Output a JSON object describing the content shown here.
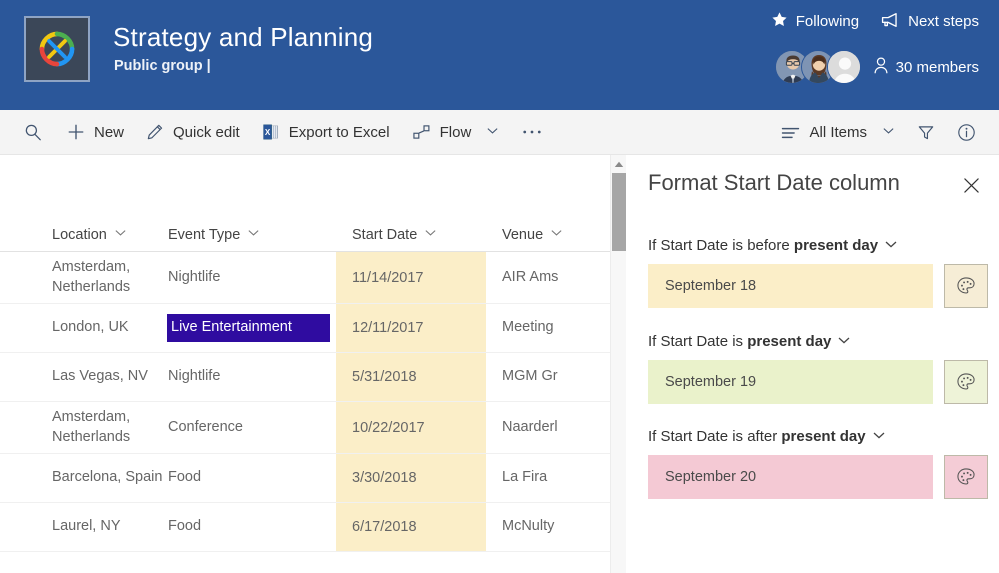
{
  "header": {
    "logo_icon": "group-knot-logo",
    "title": "Strategy and Planning",
    "subtitle": "Public group |",
    "actions": [
      {
        "icon": "star-icon",
        "label": "Following"
      },
      {
        "icon": "megaphone-icon",
        "label": "Next steps"
      }
    ],
    "members": {
      "icon": "person-icon",
      "label": "30 members",
      "avatars": [
        "avatar-man-glasses",
        "avatar-woman",
        "avatar-placeholder"
      ]
    },
    "bg_color": "#2b579a"
  },
  "command_bar": {
    "left_items": [
      {
        "icon": "search-icon",
        "label": ""
      },
      {
        "icon": "plus-icon",
        "label": "New"
      },
      {
        "icon": "pencil-icon",
        "label": "Quick edit"
      },
      {
        "icon": "excel-icon",
        "label": "Export to Excel"
      },
      {
        "icon": "flow-icon",
        "label": "Flow",
        "chevron": true
      },
      {
        "icon": "ellipsis-icon",
        "label": ""
      }
    ],
    "right_items": [
      {
        "icon": "list-icon",
        "label": "All Items",
        "chevron": true
      },
      {
        "icon": "filter-icon",
        "label": ""
      },
      {
        "icon": "info-icon",
        "label": ""
      }
    ]
  },
  "table": {
    "columns": [
      {
        "label": "Location",
        "sort_icon": "chevron-down-icon"
      },
      {
        "label": "Event Type",
        "sort_icon": "chevron-down-icon"
      },
      {
        "label": "Start Date",
        "sort_icon": "chevron-down-icon"
      },
      {
        "label": "Venue",
        "sort_icon": "chevron-down-icon"
      }
    ],
    "date_highlight_color": "#fbeec8",
    "type_highlight_bg": "#2f0ca0",
    "type_highlight_fg": "#ffffff",
    "rows": [
      {
        "location": "Amsterdam, Netherlands",
        "event_type": "Nightlife",
        "start_date": "11/14/2017",
        "venue": "AIR Ams",
        "type_highlighted": false
      },
      {
        "location": "London, UK",
        "event_type": "Live Entertainment",
        "start_date": "12/11/2017",
        "venue": "Meeting",
        "type_highlighted": true
      },
      {
        "location": "Las Vegas, NV",
        "event_type": "Nightlife",
        "start_date": "5/31/2018",
        "venue": "MGM Gr",
        "type_highlighted": false
      },
      {
        "location": "Amsterdam, Netherlands",
        "event_type": "Conference",
        "start_date": "10/22/2017",
        "venue": "Naarderl",
        "type_highlighted": false
      },
      {
        "location": "Barcelona, Spain",
        "event_type": "Food",
        "start_date": "3/30/2018",
        "venue": "La Fira",
        "type_highlighted": false
      },
      {
        "location": "Laurel, NY",
        "event_type": "Food",
        "start_date": "6/17/2018",
        "venue": "McNulty",
        "type_highlighted": false
      }
    ]
  },
  "scrollbar": {
    "up_arrow_icon": "caret-up-icon",
    "thumb_color": "#a6a6a6"
  },
  "panel": {
    "title": "Format Start Date column",
    "close_icon": "close-icon",
    "rules": [
      {
        "prefix": "If Start Date is before ",
        "condition": "present day",
        "chevron_icon": "chevron-down-icon",
        "sample_text": "September 18",
        "swatch_color": "#fbeec8",
        "palette_icon": "palette-icon",
        "palette_bg": "#f6edd6"
      },
      {
        "prefix": "If Start Date is ",
        "condition": "present day",
        "chevron_icon": "chevron-down-icon",
        "sample_text": "September 19",
        "swatch_color": "#eaf2cb",
        "palette_icon": "palette-icon",
        "palette_bg": "#eef3d8"
      },
      {
        "prefix": "If Start Date is after ",
        "condition": "present day",
        "chevron_icon": "chevron-down-icon",
        "sample_text": "September 20",
        "swatch_color": "#f4c9d4",
        "palette_icon": "palette-icon",
        "palette_bg": "#f4ccd6"
      }
    ]
  }
}
